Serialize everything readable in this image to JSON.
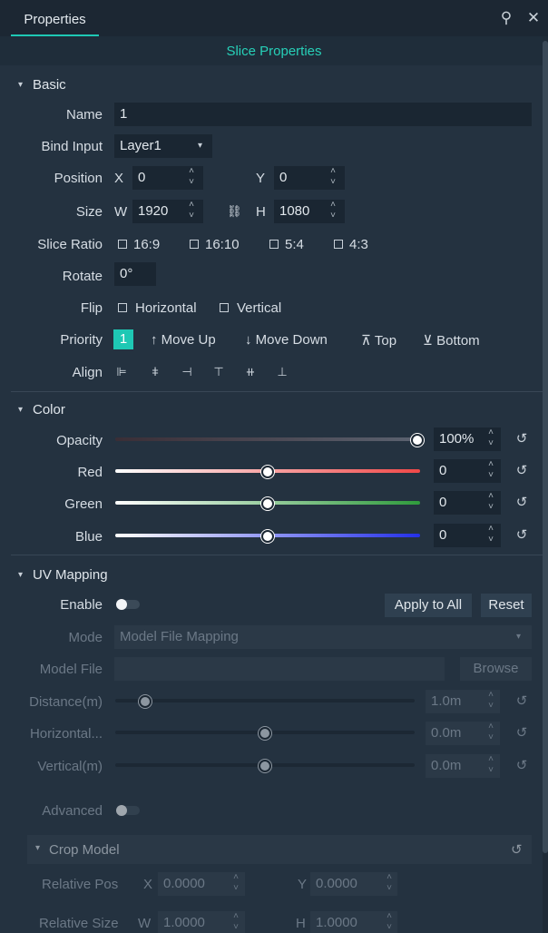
{
  "tabbar": {
    "tab_label": "Properties",
    "pin_icon": "unpin-icon",
    "close_icon": "close-icon"
  },
  "subheader": "Slice Properties",
  "basic": {
    "title": "Basic",
    "name_label": "Name",
    "name_value": "1",
    "bind_label": "Bind Input",
    "bind_value": "Layer1",
    "position_label": "Position",
    "x_label": "X",
    "x_value": "0",
    "y_label": "Y",
    "y_value": "0",
    "size_label": "Size",
    "w_label": "W",
    "w_value": "1920",
    "h_label": "H",
    "h_value": "1080",
    "ratio_label": "Slice Ratio",
    "ratios": [
      "16:9",
      "16:10",
      "5:4",
      "4:3"
    ],
    "rotate_label": "Rotate",
    "rotate_value": "0°",
    "flip_label": "Flip",
    "flip_h": "Horizontal",
    "flip_v": "Vertical",
    "priority_label": "Priority",
    "priority_value": "1",
    "move_up": "↑ Move Up",
    "move_down": "↓ Move Down",
    "top": "⊼ Top",
    "bottom": "⊻ Bottom",
    "align_label": "Align"
  },
  "color": {
    "title": "Color",
    "opacity_label": "Opacity",
    "opacity_value": "100%",
    "opacity_level": 1.0,
    "red_label": "Red",
    "red_value": "0",
    "red_level": 0.5,
    "green_label": "Green",
    "green_value": "0",
    "green_level": 0.5,
    "blue_label": "Blue",
    "blue_value": "0",
    "blue_level": 0.5
  },
  "uv": {
    "title": "UV Mapping",
    "enable_label": "Enable",
    "apply_all": "Apply to All",
    "reset": "Reset",
    "mode_label": "Mode",
    "mode_value": "Model File Mapping",
    "model_file_label": "Model File",
    "browse": "Browse",
    "distance_label": "Distance(m)",
    "distance_value": "1.0m",
    "distance_level": 0.1,
    "horizontal_label": "Horizontal...",
    "horizontal_value": "0.0m",
    "horizontal_level": 0.5,
    "vertical_label": "Vertical(m)",
    "vertical_value": "0.0m",
    "vertical_level": 0.5,
    "advanced_label": "Advanced",
    "crop_title": "Crop Model",
    "rel_pos_label": "Relative Pos",
    "rx_label": "X",
    "rx_value": "0.0000",
    "ry_label": "Y",
    "ry_value": "0.0000",
    "rel_size_label": "Relative Size",
    "rw_label": "W",
    "rw_value": "1.0000",
    "rh_label": "H",
    "rh_value": "1.0000"
  },
  "colors": {
    "accent": "#1ec8b4",
    "panel": "#243240",
    "field": "#1a2632"
  }
}
